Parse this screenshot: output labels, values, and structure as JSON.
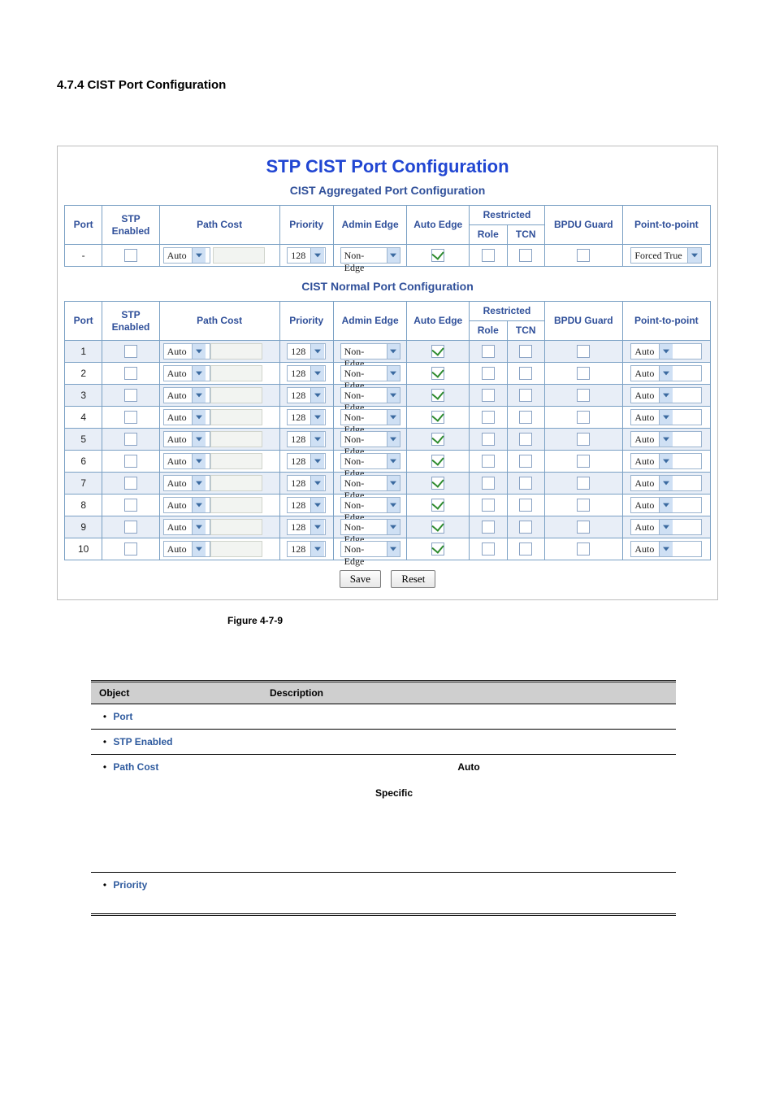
{
  "doc": {
    "heading": "4.7.4 CIST Port Configuration",
    "figure_caption": "Figure 4-7-9"
  },
  "panel": {
    "title": "STP CIST Port Configuration",
    "agg_subtitle": "CIST Aggregated Port Configuration",
    "normal_subtitle": "CIST Normal Port Configuration"
  },
  "headers": {
    "port": "Port",
    "stp_enabled": "STP Enabled",
    "path_cost": "Path Cost",
    "priority": "Priority",
    "admin_edge": "Admin Edge",
    "auto_edge": "Auto Edge",
    "restricted": "Restricted",
    "restricted_role": "Role",
    "restricted_tcn": "TCN",
    "bpdu_guard": "BPDU Guard",
    "p2p": "Point-to-point"
  },
  "agg_row": {
    "port": "-",
    "path_cost_mode": "Auto",
    "priority": "128",
    "admin_edge": "Non-Edge",
    "p2p": "Forced True"
  },
  "rows": [
    {
      "port": "1",
      "path_cost_mode": "Auto",
      "priority": "128",
      "admin_edge": "Non-Edge",
      "p2p": "Auto"
    },
    {
      "port": "2",
      "path_cost_mode": "Auto",
      "priority": "128",
      "admin_edge": "Non-Edge",
      "p2p": "Auto"
    },
    {
      "port": "3",
      "path_cost_mode": "Auto",
      "priority": "128",
      "admin_edge": "Non-Edge",
      "p2p": "Auto"
    },
    {
      "port": "4",
      "path_cost_mode": "Auto",
      "priority": "128",
      "admin_edge": "Non-Edge",
      "p2p": "Auto"
    },
    {
      "port": "5",
      "path_cost_mode": "Auto",
      "priority": "128",
      "admin_edge": "Non-Edge",
      "p2p": "Auto"
    },
    {
      "port": "6",
      "path_cost_mode": "Auto",
      "priority": "128",
      "admin_edge": "Non-Edge",
      "p2p": "Auto"
    },
    {
      "port": "7",
      "path_cost_mode": "Auto",
      "priority": "128",
      "admin_edge": "Non-Edge",
      "p2p": "Auto"
    },
    {
      "port": "8",
      "path_cost_mode": "Auto",
      "priority": "128",
      "admin_edge": "Non-Edge",
      "p2p": "Auto"
    },
    {
      "port": "9",
      "path_cost_mode": "Auto",
      "priority": "128",
      "admin_edge": "Non-Edge",
      "p2p": "Auto"
    },
    {
      "port": "10",
      "path_cost_mode": "Auto",
      "priority": "128",
      "admin_edge": "Non-Edge",
      "p2p": "Auto"
    }
  ],
  "buttons": {
    "save": "Save",
    "reset": "Reset"
  },
  "desc_table": {
    "hdr_object": "Object",
    "hdr_description": "Description",
    "rows": [
      {
        "name": "Port",
        "auto": "",
        "specific": ""
      },
      {
        "name": "STP Enabled",
        "auto": "",
        "specific": ""
      },
      {
        "name": "Path Cost",
        "auto": "Auto",
        "specific": "Specific"
      },
      {
        "name": "Priority",
        "auto": "",
        "specific": ""
      }
    ]
  }
}
